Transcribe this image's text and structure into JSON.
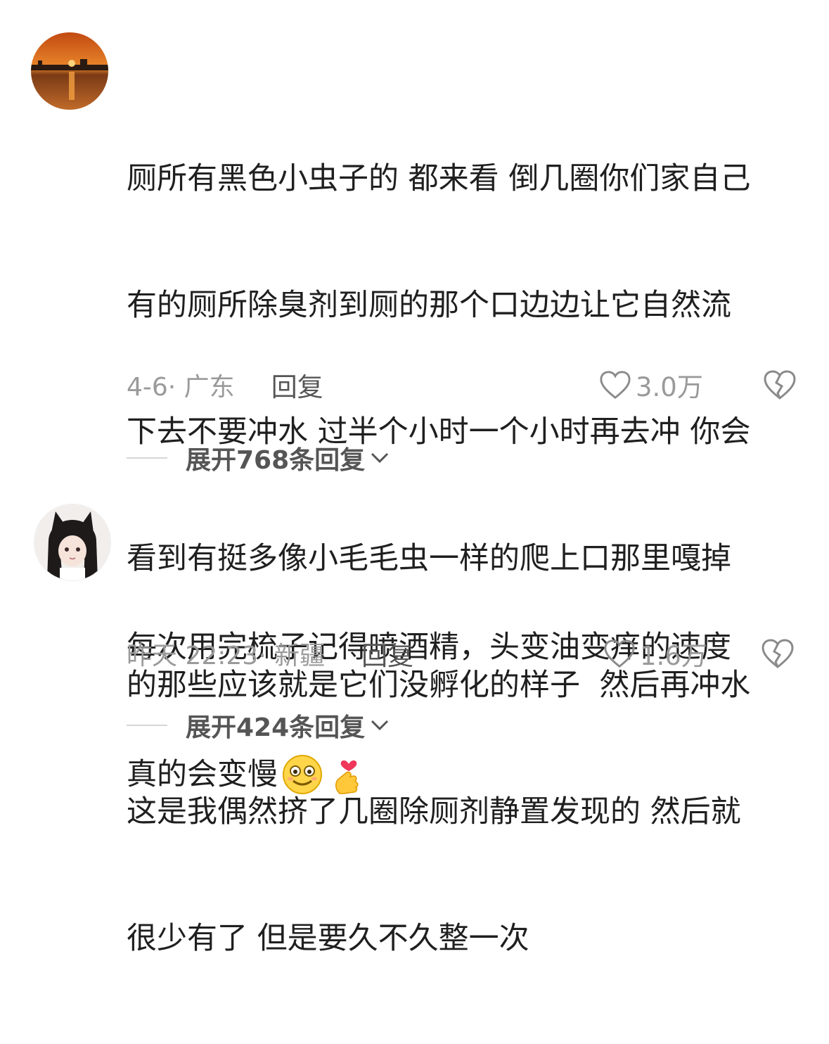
{
  "comments": [
    {
      "avatar": "sunset-avatar",
      "text": "厕所有黑色小虫子的 都来看 倒几圈你们家自己有的厕所除臭剂到厕的那个口边边让它自然流下去不要冲水 过半个小时一个小时再去冲 你会看到有挺多像小毛毛虫一样的爬上口那里嘎掉的那些应该就是它们没孵化的样子 然后再冲水 这是我偶然挤了几圈除厕剂静置发现的 然后就很少有了 但是要久不久整一次",
      "lines": [
        "厕所有黑色小虫子的 都来看 倒几圈你们家自己",
        "有的厕所除臭剂到厕的那个口边边让它自然流",
        "下去不要冲水 过半个小时一个小时再去冲 你会",
        "看到有挺多像小毛毛虫一样的爬上口那里嘎掉",
        "的那些应该就是它们没孵化的样子  然后再冲水",
        "这是我偶然挤了几圈除厕剂静置发现的 然后就",
        "很少有了 但是要久不久整一次"
      ],
      "meta": "4-6· 广东",
      "reply_label": "回复",
      "likes": "3.0万",
      "expand_label": "展开768条回复"
    },
    {
      "avatar": "anime-cat-girl-avatar",
      "lines": [
        "每次用完梳子记得喷酒精，头变油变痒的速度",
        "真的会变慢"
      ],
      "emojis": [
        "smiling-face-emoji",
        "finger-heart-emoji"
      ],
      "meta": "昨天 22:23· 新疆",
      "reply_label": "回复",
      "likes": "1.6万",
      "expand_label": "展开424条回复"
    }
  ],
  "icons": {
    "like": "heart-outline-icon",
    "dislike": "broken-heart-icon",
    "expand": "chevron-down-icon"
  },
  "colors": {
    "text": "#1f1f1f",
    "meta": "#9a9a9a",
    "reply": "#555555"
  }
}
